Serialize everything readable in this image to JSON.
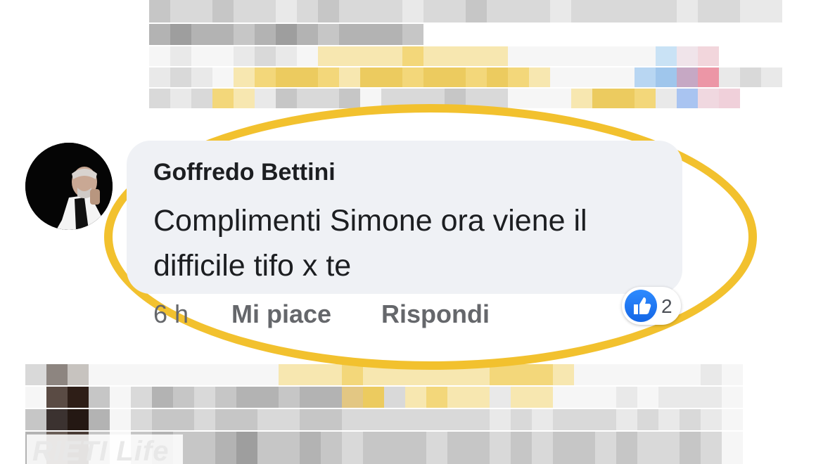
{
  "comment": {
    "author": "Goffredo Bettini",
    "text": "Complimenti Simone ora viene il difficile tifo x te",
    "time": "6 h",
    "like_label": "Mi piace",
    "reply_label": "Rispondi",
    "reaction_count": "2",
    "reaction_icon": "thumbs-up-icon"
  },
  "watermark": {
    "text": "RIETI Life"
  },
  "colors": {
    "highlight": "#f2c12e",
    "bubble": "#eff1f5",
    "like_blue": "#1877f2"
  }
}
